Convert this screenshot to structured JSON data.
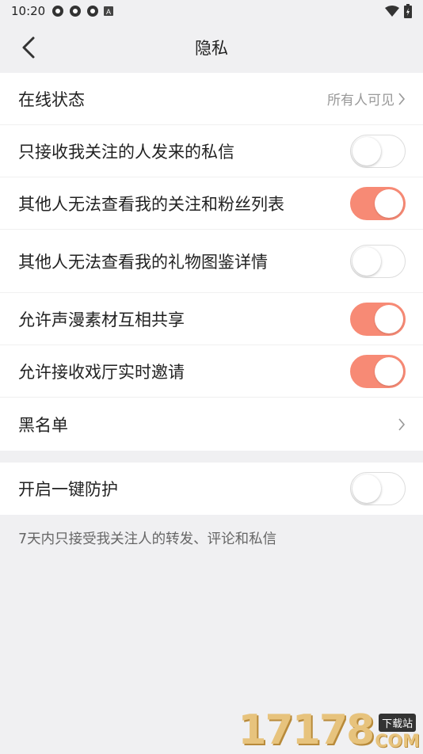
{
  "status_bar": {
    "time": "10:20",
    "notification_icons": [
      "sync-icon",
      "sync-icon",
      "sync-icon",
      "a-box-icon"
    ],
    "right_icons": [
      "wifi-icon",
      "battery-charging-icon"
    ]
  },
  "nav": {
    "title": "隐私",
    "back_icon": "chevron-left-icon"
  },
  "settings_group_1": [
    {
      "key": "online_status",
      "label": "在线状态",
      "type": "link",
      "value": "所有人可见"
    },
    {
      "key": "only_follow_dm",
      "label": "只接收我关注的人发来的私信",
      "type": "toggle",
      "on": false
    },
    {
      "key": "hide_follow_list",
      "label": "其他人无法查看我的关注和粉丝列表",
      "type": "toggle",
      "on": true
    },
    {
      "key": "hide_gift_book",
      "label": "其他人无法查看我的礼物图鉴详情",
      "type": "toggle",
      "on": false
    },
    {
      "key": "share_assets",
      "label": "允许声漫素材互相共享",
      "type": "toggle",
      "on": true
    },
    {
      "key": "accept_invite",
      "label": "允许接收戏厅实时邀请",
      "type": "toggle",
      "on": true
    },
    {
      "key": "blacklist",
      "label": "黑名单",
      "type": "link",
      "value": ""
    }
  ],
  "settings_group_2": [
    {
      "key": "one_click_protect",
      "label": "开启一键防护",
      "type": "toggle",
      "on": false
    }
  ],
  "footnote": "7天内只接受我关注人的转发、评论和私信",
  "colors": {
    "toggle_on": "#f78a75",
    "background": "#f0f0f2"
  },
  "watermark": {
    "number": "17178",
    "tag": "下载站",
    "domain": "COM"
  }
}
